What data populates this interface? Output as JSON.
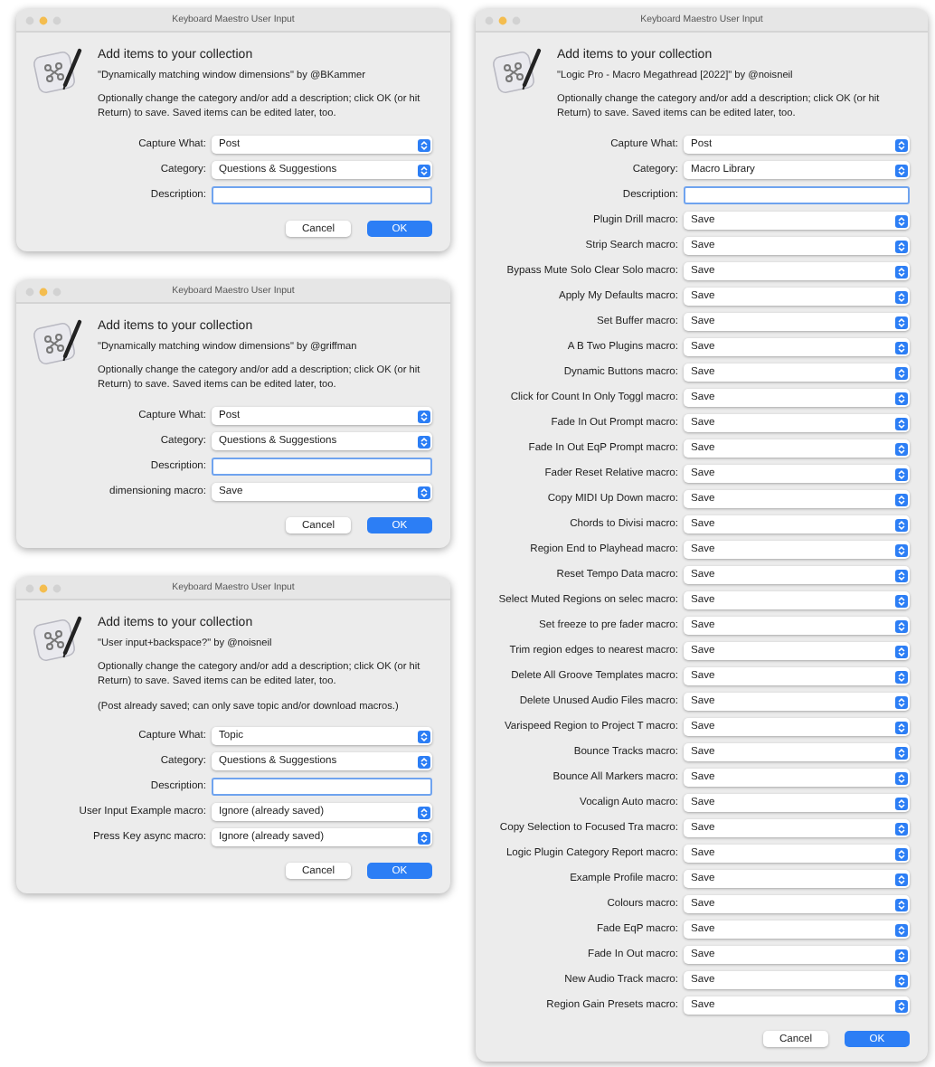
{
  "dialogs": [
    {
      "title": "Keyboard Maestro User Input",
      "heading": "Add items to your collection",
      "subtitle": "\"Dynamically matching window dimensions\" by @BKammer",
      "notice": "Optionally change the category and/or add a description; click OK (or hit Return) to save. Saved items can be edited later, too.",
      "fields": [
        {
          "kind": "popup",
          "label": "Capture What:",
          "value": "Post"
        },
        {
          "kind": "popup",
          "label": "Category:",
          "value": "Questions & Suggestions"
        },
        {
          "kind": "text",
          "label": "Description:",
          "focused": true
        }
      ],
      "buttons": [
        {
          "kind": "cancel",
          "label": "Cancel"
        },
        {
          "kind": "default",
          "label": "OK"
        }
      ]
    },
    {
      "title": "Keyboard Maestro User Input",
      "heading": "Add items to your collection",
      "subtitle": "\"Dynamically matching window dimensions\" by @griffman",
      "notice": "Optionally change the category and/or add a description; click OK (or hit Return) to save. Saved items can be edited later, too.",
      "fields": [
        {
          "kind": "popup",
          "label": "Capture What:",
          "value": "Post"
        },
        {
          "kind": "popup",
          "label": "Category:",
          "value": "Questions & Suggestions"
        },
        {
          "kind": "text",
          "label": "Description:",
          "focused": true
        },
        {
          "kind": "popup",
          "label": "dimensioning macro:",
          "value": "Save"
        }
      ],
      "buttons": [
        {
          "kind": "cancel",
          "label": "Cancel"
        },
        {
          "kind": "default",
          "label": "OK"
        }
      ]
    },
    {
      "title": "Keyboard Maestro User Input",
      "heading": "Add items to your collection",
      "subtitle": "\"User input+backspace?\" by @noisneil",
      "notice": "Optionally change the category and/or add a description; click OK (or hit Return) to save. Saved items can be edited later, too.",
      "note": "(Post already saved; can only save topic and/or download macros.)",
      "fields": [
        {
          "kind": "popup",
          "label": "Capture What:",
          "value": "Topic"
        },
        {
          "kind": "popup",
          "label": "Category:",
          "value": "Questions & Suggestions"
        },
        {
          "kind": "text",
          "label": "Description:",
          "focused": true
        },
        {
          "kind": "popup",
          "label": "User Input Example macro:",
          "value": "Ignore (already saved)"
        },
        {
          "kind": "popup",
          "label": "Press Key async macro:",
          "value": "Ignore (already saved)"
        }
      ],
      "buttons": [
        {
          "kind": "cancel",
          "label": "Cancel"
        },
        {
          "kind": "default",
          "label": "OK"
        }
      ]
    },
    {
      "title": "Keyboard Maestro User Input",
      "heading": "Add items to your collection",
      "subtitle": "\"Logic Pro - Macro Megathread [2022]\" by @noisneil",
      "notice": "Optionally change the category and/or add a description; click OK (or hit Return) to save. Saved items can be edited later, too.",
      "fields": [
        {
          "kind": "popup",
          "label": "Capture What:",
          "value": "Post"
        },
        {
          "kind": "popup",
          "label": "Category:",
          "value": "Macro Library"
        },
        {
          "kind": "text",
          "label": "Description:",
          "focused": true
        },
        {
          "kind": "popup",
          "label": "Plugin Drill macro:",
          "value": "Save"
        },
        {
          "kind": "popup",
          "label": "Strip Search macro:",
          "value": "Save"
        },
        {
          "kind": "popup",
          "label": "Bypass Mute Solo Clear Solo macro:",
          "value": "Save"
        },
        {
          "kind": "popup",
          "label": "Apply My Defaults macro:",
          "value": "Save"
        },
        {
          "kind": "popup",
          "label": "Set Buffer macro:",
          "value": "Save"
        },
        {
          "kind": "popup",
          "label": "A B Two Plugins macro:",
          "value": "Save"
        },
        {
          "kind": "popup",
          "label": "Dynamic Buttons macro:",
          "value": "Save"
        },
        {
          "kind": "popup",
          "label": "Click for Count In Only Toggl macro:",
          "value": "Save"
        },
        {
          "kind": "popup",
          "label": "Fade In Out Prompt macro:",
          "value": "Save"
        },
        {
          "kind": "popup",
          "label": "Fade In Out EqP Prompt macro:",
          "value": "Save"
        },
        {
          "kind": "popup",
          "label": "Fader Reset Relative macro:",
          "value": "Save"
        },
        {
          "kind": "popup",
          "label": "Copy MIDI Up Down macro:",
          "value": "Save"
        },
        {
          "kind": "popup",
          "label": "Chords to Divisi macro:",
          "value": "Save"
        },
        {
          "kind": "popup",
          "label": "Region End to Playhead macro:",
          "value": "Save"
        },
        {
          "kind": "popup",
          "label": "Reset Tempo Data macro:",
          "value": "Save"
        },
        {
          "kind": "popup",
          "label": "Select Muted Regions on selec macro:",
          "value": "Save"
        },
        {
          "kind": "popup",
          "label": "Set freeze to pre fader macro:",
          "value": "Save"
        },
        {
          "kind": "popup",
          "label": "Trim region edges to nearest macro:",
          "value": "Save"
        },
        {
          "kind": "popup",
          "label": "Delete All Groove Templates macro:",
          "value": "Save"
        },
        {
          "kind": "popup",
          "label": "Delete Unused Audio Files macro:",
          "value": "Save"
        },
        {
          "kind": "popup",
          "label": "Varispeed Region to Project T macro:",
          "value": "Save"
        },
        {
          "kind": "popup",
          "label": "Bounce Tracks macro:",
          "value": "Save"
        },
        {
          "kind": "popup",
          "label": "Bounce All Markers macro:",
          "value": "Save"
        },
        {
          "kind": "popup",
          "label": "Vocalign Auto macro:",
          "value": "Save"
        },
        {
          "kind": "popup",
          "label": "Copy Selection to Focused Tra macro:",
          "value": "Save"
        },
        {
          "kind": "popup",
          "label": "Logic Plugin Category Report macro:",
          "value": "Save"
        },
        {
          "kind": "popup",
          "label": "Example Profile macro:",
          "value": "Save"
        },
        {
          "kind": "popup",
          "label": "Colours macro:",
          "value": "Save"
        },
        {
          "kind": "popup",
          "label": "Fade EqP macro:",
          "value": "Save"
        },
        {
          "kind": "popup",
          "label": "Fade In Out macro:",
          "value": "Save"
        },
        {
          "kind": "popup",
          "label": "New Audio Track macro:",
          "value": "Save"
        },
        {
          "kind": "popup",
          "label": "Region Gain Presets macro:",
          "value": "Save"
        }
      ],
      "buttons": [
        {
          "kind": "cancel",
          "label": "Cancel"
        },
        {
          "kind": "default",
          "label": "OK"
        }
      ]
    }
  ]
}
